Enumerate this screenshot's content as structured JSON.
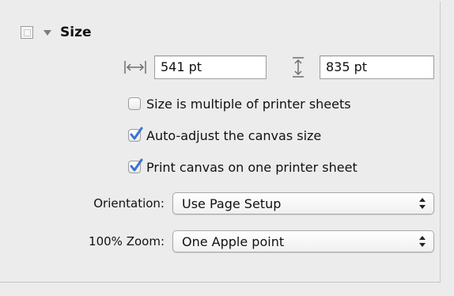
{
  "section": {
    "title": "Size",
    "icon": "inspector-icon",
    "disclosure": "disclosure-triangle-expanded"
  },
  "size": {
    "width_value": "541 pt",
    "height_value": "835 pt"
  },
  "checkboxes": [
    {
      "label": "Size is multiple of printer sheets",
      "checked": false
    },
    {
      "label": "Auto-adjust the canvas size",
      "checked": true
    },
    {
      "label": "Print canvas on one printer sheet",
      "checked": true
    }
  ],
  "orientation": {
    "label": "Orientation:",
    "value": "Use Page Setup"
  },
  "zoom": {
    "label": "100% Zoom:",
    "value": "One Apple point"
  },
  "colors": {
    "panel_background": "#ececec",
    "checkbox_accent": "#3a73d6"
  }
}
